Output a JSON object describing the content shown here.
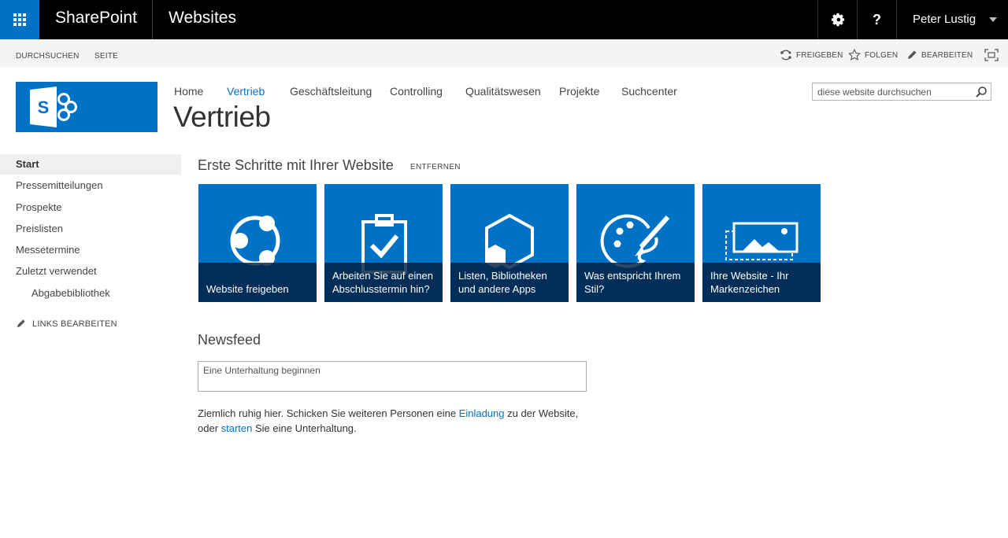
{
  "suite": {
    "brand": "SharePoint",
    "title": "Websites",
    "help_label": "?",
    "user_name": "Peter Lustig"
  },
  "ribbon": {
    "tabs": [
      "DURCHSUCHEN",
      "SEITE"
    ],
    "share": "FREIGEBEN",
    "follow": "FOLGEN",
    "edit": "BEARBEITEN"
  },
  "topnav": {
    "items": [
      "Home",
      "Vertrieb",
      "Geschäftsleitung",
      "Controlling",
      "Qualitätswesen",
      "Projekte",
      "Suchcenter"
    ],
    "active": "Vertrieb"
  },
  "site": {
    "title": "Vertrieb",
    "logo_letter": "S"
  },
  "search": {
    "placeholder": "diese website durchsuchen"
  },
  "quicklaunch": {
    "items": [
      "Start",
      "Pressemitteilungen",
      "Prospekte",
      "Preislisten",
      "Messetermine",
      "Zuletzt verwendet"
    ],
    "sub_items": [
      "Abgabebibliothek"
    ],
    "edit_links": "LINKS BEARBEITEN"
  },
  "getting_started": {
    "heading": "Erste Schritte mit Ihrer Website",
    "remove": "ENTFERNEN",
    "tiles": [
      {
        "label": "Website freigeben",
        "icon": "share-icon"
      },
      {
        "label": "Arbeiten Sie auf einen Abschlusstermin hin?",
        "icon": "clipboard-check-icon"
      },
      {
        "label": "Listen, Bibliotheken und andere Apps",
        "icon": "hexagon-apps-icon"
      },
      {
        "label": "Was entspricht Ihrem Stil?",
        "icon": "palette-icon"
      },
      {
        "label": "Ihre Website - Ihr Markenzeichen",
        "icon": "brand-image-icon"
      }
    ]
  },
  "newsfeed": {
    "heading": "Newsfeed",
    "placeholder": "Eine Unterhaltung beginnen",
    "quiet_part1": "Ziemlich ruhig hier. Schicken Sie weiteren Personen eine ",
    "invite_link": "Einladung",
    "quiet_part2": " zu der Website,",
    "quiet_part3": "oder ",
    "start_link": "starten",
    "quiet_part4": " Sie eine Unterhaltung."
  },
  "colors": {
    "accent": "#0072c6",
    "suitebar": "#000000",
    "ribbon": "#f4f4f4"
  }
}
